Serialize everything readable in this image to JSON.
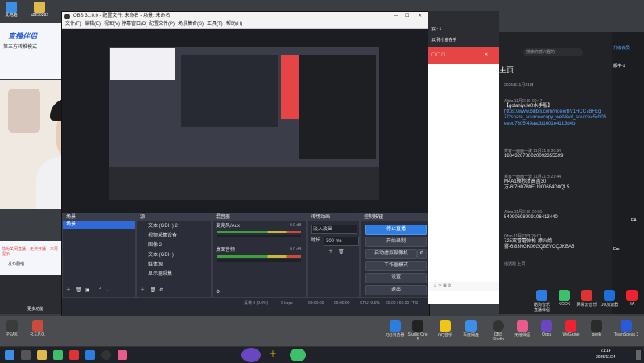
{
  "desktop_icons": [
    {
      "label": "此电脑",
      "icon": "computer-icon",
      "color": "#3c8ee6"
    },
    {
      "label": "a2250282",
      "icon": "folder-icon",
      "color": "#e0b94c"
    },
    {
      "label": "Q",
      "icon": "app-icon",
      "color": "#444"
    }
  ],
  "stream_overlay": {
    "brand": "直播伴侣",
    "item1": "第三方转推模式",
    "warning": "前为关闭直播…无法开播…不再提示",
    "publish_label": "发布翻唱",
    "more": "更多功能"
  },
  "obs": {
    "title": "OBS 31.0.0 - 配置文件: 未命名 - 场景: 未命名",
    "menu": [
      "文件(F)",
      "编辑(E)",
      "视图(V)",
      "停靠窗口(D)",
      "配置文件(P)",
      "场景集合(S)",
      "工具(T)",
      "帮助(H)"
    ],
    "scenes": {
      "title": "场景",
      "items": [
        "场景"
      ]
    },
    "sources": {
      "title": "源",
      "items": [
        "文本 (GDI+) 2",
        "视频采集设备",
        "图像 2",
        "文本 (GDI+)",
        "媒体源",
        "显示器采集"
      ]
    },
    "mixer": {
      "title": "混音器",
      "tracks": [
        {
          "name": "麦克风/Aux",
          "db": "0.0 dB",
          "level": 0.6
        },
        {
          "name": "桌面音频",
          "db": "0.0 dB",
          "level": 0.55
        }
      ]
    },
    "transitions": {
      "title": "转场动画",
      "type": "淡入淡出",
      "duration_label": "时长",
      "duration": "300 ms"
    },
    "controls": {
      "title": "控制按钮",
      "buttons": [
        "停止直播",
        "开始录制",
        "启动虚拟摄像机",
        "工作室模式",
        "设置",
        "退出"
      ]
    },
    "status": {
      "dropped": "丢帧 0 (0.0%)",
      "bitrate": "0 kbps",
      "rec": "00:00:00",
      "live": "00:00:00",
      "cpu": "CPU: 0.5%",
      "fps": "60.00 / 60.00 FPS"
    }
  },
  "browser": {
    "title": "云 - 1",
    "tab_hint": "云 弥小鱼在乎"
  },
  "chat": {
    "search": "搜索你感兴趣的",
    "home": "主页",
    "date": "2025年11月21日",
    "side_badge": "升级会员",
    "messages": [
      {
        "name": "Altria",
        "time": "11月21日 00:47",
        "text": "【golaniyule0水手服】",
        "link": "https://www.bilibili.com/video/BV1HCC7BFEgZ/?share_source=copy_web&vd_source=5cb05eeed7305f49aa2b1601e41b3d4b"
      },
      {
        "name": "乘客一面面一波",
        "time": "11月21日 20:34",
        "text": "1884326788020092355599",
        "link": ""
      },
      {
        "name": "乘客一面面一波",
        "time": "11月21日 21:44",
        "text": "M4A1颗秒溃高盖30 万-6f7H0780EU900684D8QL5",
        "link": ""
      },
      {
        "name": "Altria",
        "time": "11月21日 20:01",
        "text": "5409069890910641344​0",
        "link": ""
      },
      {
        "name": "Ohio",
        "time": "11月21日 20:01",
        "text": "725双冒蘑弹枪-燎火炮 雾-6I83NGK06GQ8EVCQJKBA5",
        "link": ""
      }
    ],
    "input_hint": "插话题 主页",
    "right_labels": [
      "顺丰-1",
      "EA",
      "Fre"
    ]
  },
  "taskbar": {
    "apps": [
      "PEAK",
      "R.E.P.O.",
      "QQ浏览器",
      "Studio One 5",
      "QQ音乐",
      "百度网盘",
      "OBS Studio",
      "无他伴侣",
      "Oopz",
      "WeGame",
      "geek",
      "TeamSpeak 3"
    ],
    "tray_apps": [
      "QQ",
      "微信"
    ],
    "time": "21:14",
    "date": "2025/11/24"
  },
  "bottom_apps_top": [
    {
      "label": "酷狗音乐 直播伴侣",
      "color": "#2d7de0"
    },
    {
      "label": "KOOK",
      "color": "#3cc06a"
    },
    {
      "label": "网易云音乐",
      "color": "#d33"
    },
    {
      "label": "UU加速器",
      "color": "#1e6fd9"
    },
    {
      "label": "EA",
      "color": "#e23"
    }
  ],
  "colors": {
    "accent": "#2f7de0",
    "stop_live": "#2f7de0",
    "browser_red": "#e64545"
  }
}
